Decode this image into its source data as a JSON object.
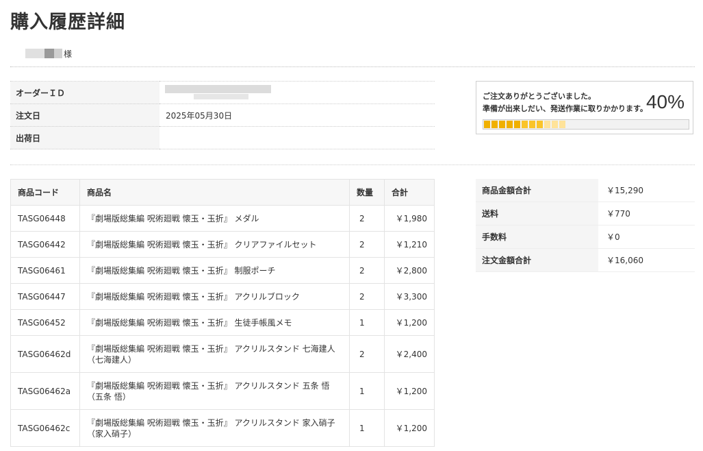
{
  "title": "購入履歴詳細",
  "customer": {
    "suffix": "様"
  },
  "order_info": [
    {
      "label": "オーダーＩＤ",
      "value": ""
    },
    {
      "label": "注文日",
      "value": "2025年05月30日"
    },
    {
      "label": "出荷日",
      "value": ""
    }
  ],
  "status": {
    "line1": "ご注文ありがとうございました。",
    "line2": "準備が出来しだい、発送作業に取りかかります。",
    "percent_label": "40%",
    "progress": 0.4,
    "colors": [
      "#f0b000",
      "#fac42a",
      "#ffe39a"
    ]
  },
  "items_table": {
    "headers": {
      "code": "商品コード",
      "name": "商品名",
      "qty": "数量",
      "total": "合計"
    },
    "rows": [
      {
        "code": "TASG06448",
        "name": "『劇場版総集編 呪術廻戦 懐玉・玉折』 メダル",
        "qty": "2",
        "total": "￥1,980"
      },
      {
        "code": "TASG06442",
        "name": "『劇場版総集編 呪術廻戦 懐玉・玉折』 クリアファイルセット",
        "qty": "2",
        "total": "￥1,210"
      },
      {
        "code": "TASG06461",
        "name": "『劇場版総集編 呪術廻戦 懐玉・玉折』 制服ポーチ",
        "qty": "2",
        "total": "￥2,800"
      },
      {
        "code": "TASG06447",
        "name": "『劇場版総集編 呪術廻戦 懐玉・玉折』 アクリルブロック",
        "qty": "2",
        "total": "￥3,300"
      },
      {
        "code": "TASG06452",
        "name": "『劇場版総集編 呪術廻戦 懐玉・玉折』 生徒手帳風メモ",
        "qty": "1",
        "total": "￥1,200"
      },
      {
        "code": "TASG06462d",
        "name": "『劇場版総集編 呪術廻戦 懐玉・玉折』 アクリルスタンド 七海建人（七海建人）",
        "qty": "2",
        "total": "￥2,400"
      },
      {
        "code": "TASG06462a",
        "name": "『劇場版総集編 呪術廻戦 懐玉・玉折』 アクリルスタンド 五条 悟（五条 悟）",
        "qty": "1",
        "total": "￥1,200"
      },
      {
        "code": "TASG06462c",
        "name": "『劇場版総集編 呪術廻戦 懐玉・玉折』 アクリルスタンド 家入硝子（家入硝子）",
        "qty": "1",
        "total": "￥1,200"
      }
    ]
  },
  "totals": [
    {
      "label": "商品金額合計",
      "value": "￥15,290"
    },
    {
      "label": "送料",
      "value": "￥770"
    },
    {
      "label": "手数料",
      "value": "￥0"
    },
    {
      "label": "注文金額合計",
      "value": "￥16,060"
    }
  ]
}
